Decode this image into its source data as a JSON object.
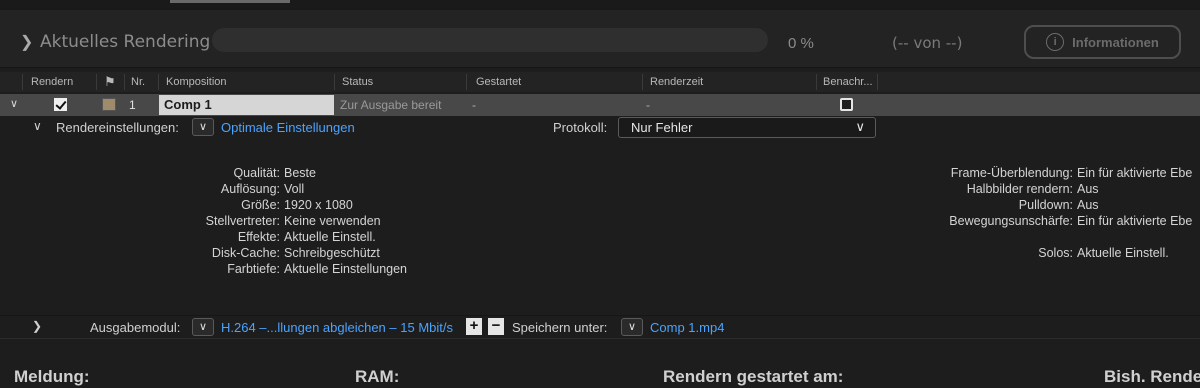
{
  "render_bar": {
    "title": "Aktuelles Rendering",
    "progress_percent": 0,
    "progress_label": "0 %",
    "count_label": "(-- von --)",
    "info_button": "Informationen"
  },
  "columns": {
    "render": "Rendern",
    "number": "Nr.",
    "composition": "Komposition",
    "status": "Status",
    "started": "Gestartet",
    "render_time": "Renderzeit",
    "notify": "Benachr..."
  },
  "item": {
    "number": "1",
    "composition": "Comp 1",
    "status": "Zur Ausgabe bereit",
    "started": "-",
    "render_time": "-",
    "render_checked": true,
    "notify_checked": false,
    "label_color": "#a08a6c"
  },
  "render_settings": {
    "label": "Rendereinstellungen:",
    "value": "Optimale Einstellungen",
    "log_label": "Protokoll:",
    "log_value": "Nur Fehler"
  },
  "details_left": [
    {
      "key": "Qualität:",
      "value": "Beste"
    },
    {
      "key": "Auflösung:",
      "value": "Voll"
    },
    {
      "key": "Größe:",
      "value": "1920 x 1080"
    },
    {
      "key": "Stellvertreter:",
      "value": "Keine verwenden"
    },
    {
      "key": "Effekte:",
      "value": "Aktuelle Einstell."
    },
    {
      "key": "Disk-Cache:",
      "value": "Schreibgeschützt"
    },
    {
      "key": "Farbtiefe:",
      "value": "Aktuelle Einstellungen"
    }
  ],
  "details_right": [
    {
      "key": "Frame-Überblendung:",
      "value": "Ein für aktivierte Ebe"
    },
    {
      "key": "Halbbilder rendern:",
      "value": "Aus"
    },
    {
      "key": "Pulldown:",
      "value": "Aus"
    },
    {
      "key": "Bewegungsunschärfe:",
      "value": "Ein für aktivierte Ebe"
    },
    {
      "key": "Solos:",
      "value": "Aktuelle Einstell."
    }
  ],
  "output": {
    "label": "Ausgabemodul:",
    "value": "H.264 –...llungen abgleichen – 15 Mbit/s",
    "add": "+",
    "remove": "−",
    "save_label": "Speichern unter:",
    "save_value": "Comp 1.mp4"
  },
  "footer": {
    "message": "Meldung:",
    "ram": "RAM:",
    "started_at": "Rendern gestartet am:",
    "elapsed": "Bish. Render"
  },
  "colors": {
    "accent_link": "#4aa3ff",
    "progress": "#3d7fd0"
  }
}
